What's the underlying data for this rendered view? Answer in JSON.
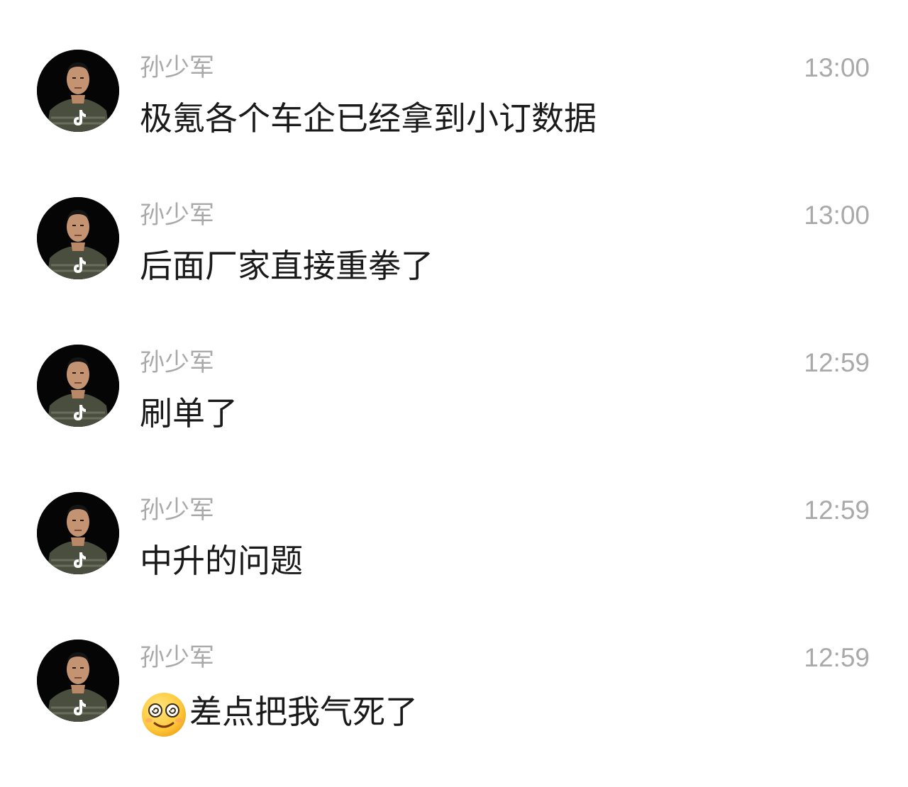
{
  "messages": [
    {
      "sender": "孙少军",
      "time": "13:00",
      "text": "极氪各个车企已经拿到小订数据",
      "emoji": ""
    },
    {
      "sender": "孙少军",
      "time": "13:00",
      "text": "后面厂家直接重拳了",
      "emoji": ""
    },
    {
      "sender": "孙少军",
      "time": "12:59",
      "text": "刷单了",
      "emoji": ""
    },
    {
      "sender": "孙少军",
      "time": "12:59",
      "text": "中升的问题",
      "emoji": ""
    },
    {
      "sender": "孙少军",
      "time": "12:59",
      "text": "差点把我气死了",
      "emoji": "dizzy-smile-emoji"
    }
  ],
  "colors": {
    "background": "#ffffff",
    "meta_text": "#a9a9a9",
    "message_text": "#1a1a1a",
    "avatar_bg": "#050505"
  },
  "icons": {
    "avatar_badge": "tiktok-logo-icon"
  }
}
